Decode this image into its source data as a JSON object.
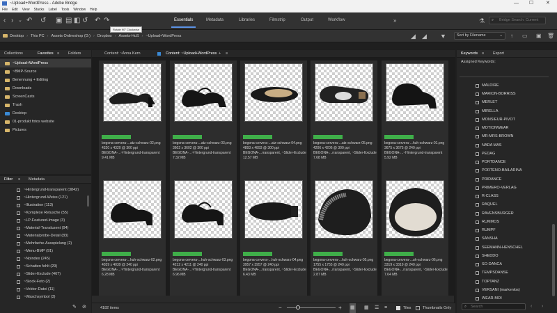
{
  "window": {
    "title": "~Upload+WordPress - Adobe Bridge",
    "min": "—",
    "max": "☐",
    "close": "✕"
  },
  "menu": [
    "File",
    "Edit",
    "View",
    "Stacks",
    "Label",
    "Tools",
    "Window",
    "Help"
  ],
  "workspaces": [
    "Essentials",
    "Metadata",
    "Libraries",
    "Filmstrip",
    "Output",
    "Workflow"
  ],
  "tooltip": "Rotate 90° Clockwise",
  "search": {
    "placeholder": "Bridge Search: Current"
  },
  "breadcrumbs": [
    "Desktop",
    "This PC",
    "Assets Onlineshop (D:)",
    "Dropbox",
    "Assets-HuS",
    "~Upload+WordPress"
  ],
  "sort": {
    "value": "Sort by Filename"
  },
  "left_tabs": [
    "Collections",
    "Favorites",
    "Folders"
  ],
  "favorites": [
    "~Upload+WordPress",
    "~BMP-Source",
    "Benennung + Editing",
    "Downloads",
    "ScreenCasts",
    "Trash",
    "Desktop",
    "01-produkt fotos website",
    "Pictures"
  ],
  "filter_tabs": [
    "Filter",
    "Metadata"
  ],
  "filter_items": [
    "~Hintergrund-transparent (3842)",
    "~Hintergrund-Weiss (121)",
    "~Illustration (113)",
    "~Komplexe Retusche (55)",
    "~LP-Featured-Image (3)",
    "~Material-Transluzent (94)",
    "~Materialprobe-Detail (83)",
    "~Mehrfache-Ausspielung (2)",
    "~Menu-BMP (91)",
    "~Noindex (245)",
    "~Schatten fehlt (29)",
    "~Slider-Exclude (467)",
    "~Stock-Foto (2)",
    "~Vektor-Datei (11)",
    "~Waschsymbol (3)"
  ],
  "content_tabs": [
    "Content: ~Anna Kern",
    "Content: ~Upload+WordPress"
  ],
  "thumbnails": [
    {
      "name": "begona-cervera-...atz-schwarz-02.png",
      "dims": "4320 x 4320 @ 300 ppi",
      "kw": "BEGONA-...~Hintergrund-transparent",
      "size": "9.41 MB"
    },
    {
      "name": "begona-cervera-...atz-schwarz-03.png",
      "dims": "3602 x 3602 @ 300 ppi",
      "kw": "BEGONA-...~Hintergrund-transparent",
      "size": "7.32 MB"
    },
    {
      "name": "begona-cervera-...atz-schwarz-04.png",
      "dims": "4893 x 4893 @ 300 ppi",
      "kw": "BEGONA-...rransparent, ~Slider-Exclude",
      "size": "12.57 MB"
    },
    {
      "name": "begona-cervera-...atz-schwarz-05.png",
      "dims": "4206 x 4206 @ 300 ppi",
      "kw": "BEGONA-...rransparent, ~Slider-Exclude",
      "size": "7.68 MB"
    },
    {
      "name": "begona-cervera-...huh-schwarz-01.png",
      "dims": "3675 x 3675 @ 240 ppi",
      "kw": "BEGONA-...~Hintergrund-transparent",
      "size": "5.92 MB"
    },
    {
      "name": "begona-cervera-...huh-schwarz-02.png",
      "dims": "4039 x 4039 @ 240 ppi",
      "kw": "BEGONA-...~Hintergrund-transparent",
      "size": "6.28 MB"
    },
    {
      "name": "begona-cervera-...huh-schwarz-03.png",
      "dims": "4212 x 4211 @ 240 ppi",
      "kw": "BEGONA-...~Hintergrund-transparent",
      "size": "6.96 MB"
    },
    {
      "name": "begona-cervera-...huh-schwarz-04.png",
      "dims": "3957 x 3957 @ 240 ppi",
      "kw": "BEGONA-...rransparent, ~Slider-Exclude",
      "size": "6.43 MB"
    },
    {
      "name": "begona-cervera-...huh-schwarz-05.png",
      "dims": "1755 x 1755 @ 240 ppi",
      "kw": "BEGONA-...rransparent, ~Slider-Exclude",
      "size": "2.87 MB"
    },
    {
      "name": "begona-cervera-...uh-schwarz-06.png",
      "dims": "3319 x 3319 @ 240 ppi",
      "kw": "BEGONA-...rransparent, ~Slider-Exclude",
      "size": "7.64 MB"
    }
  ],
  "status": {
    "items": "4182 items",
    "tiles": "Tiles",
    "thumbs_only": "Thumbnails Only"
  },
  "right_tabs": [
    "Keywords",
    "Export"
  ],
  "assigned_label": "Assigned Keywords:",
  "keywords": [
    "MALDIRE",
    "MARION-BORRISS",
    "MERLET",
    "MIRELLA",
    "MONSIEUR-PIVOT",
    "MOTIONWEAR",
    "MR-MRS-BROWN",
    "NADA MAS",
    "PEDAG",
    "PORTDANCE",
    "PORTENO-BAILARINA",
    "PRIDANCE",
    "PRIMERO-VERLAG",
    "R-CLASS",
    "RAQUEL",
    "RAVENSBURGER",
    "RUMMOS",
    "RUMPF",
    "SANSHA",
    "SEEMANN-HENSCHEL",
    "SHEDDO",
    "SO-DANCA",
    "TEMPSDANSE",
    "TOPTANZ",
    "VERSANI (markenlos)",
    "WEAR-MOI"
  ],
  "kw_search": {
    "placeholder": "Search"
  },
  "colors": {
    "accent": "#5c93e6",
    "label_green": "#3fae49",
    "folder": "#d6b56a"
  }
}
